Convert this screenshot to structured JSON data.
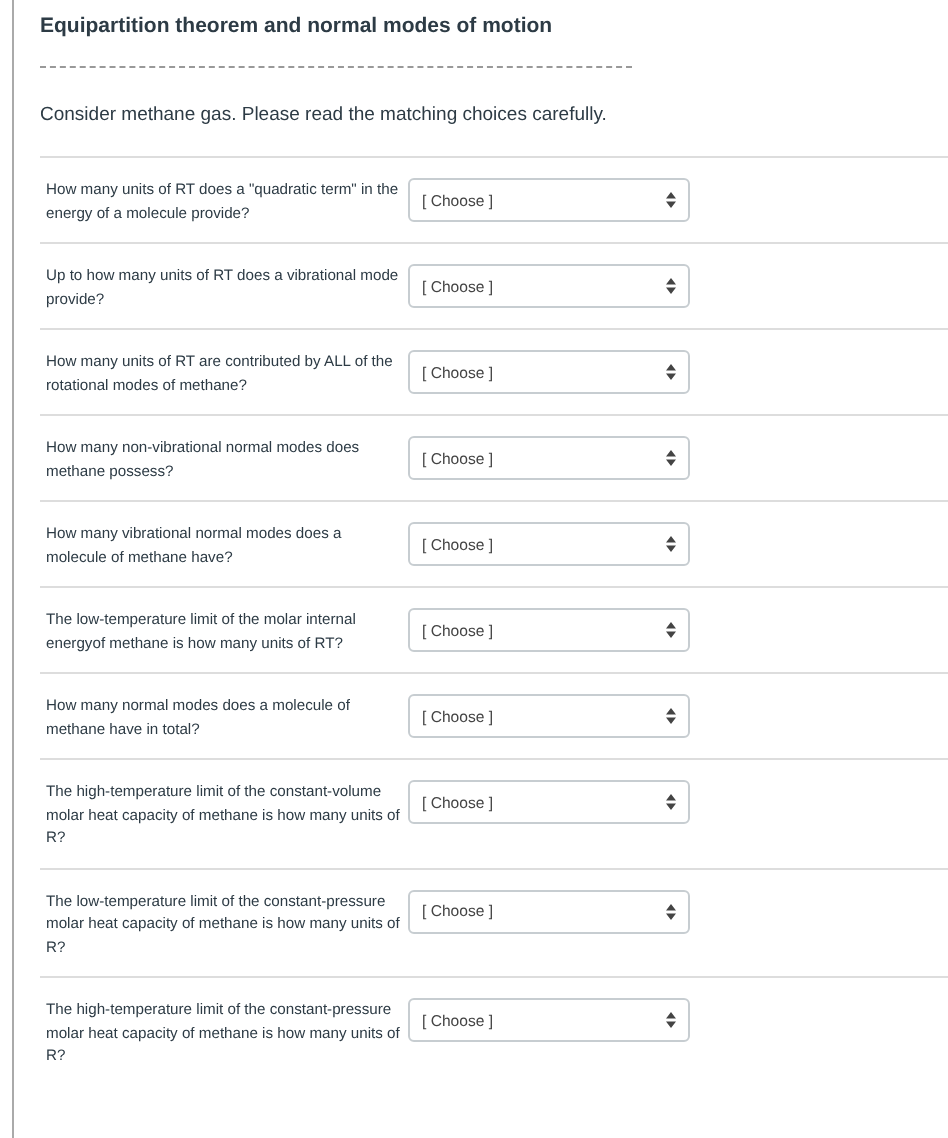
{
  "title": "Equipartition theorem and normal modes of motion",
  "intro": "Consider methane gas.  Please read the matching choices carefully.",
  "questions": [
    {
      "text": "How many units of RT does a \"quadratic term\" in the energy of a molecule provide?",
      "choice": "[ Choose ]"
    },
    {
      "text": "Up to how many units of RT does a vibrational mode provide?",
      "choice": "[ Choose ]"
    },
    {
      "text": "How many units of RT are contributed by ALL of the rotational modes of methane?",
      "choice": "[ Choose ]"
    },
    {
      "text": "How many non-vibrational normal modes does methane possess?",
      "choice": "[ Choose ]"
    },
    {
      "text": "How many vibrational normal modes does a molecule of methane have?",
      "choice": "[ Choose ]"
    },
    {
      "text": "The low-temperature limit of the molar internal energyof methane is how many units of RT?",
      "choice": "[ Choose ]"
    },
    {
      "text": "How many normal modes does a molecule of methane have in total?",
      "choice": "[ Choose ]"
    },
    {
      "text": "The high-temperature limit of the constant-volume molar heat capacity of methane is how many units of R?",
      "choice": "[ Choose ]"
    },
    {
      "text": "The low-temperature limit of the constant-pressure molar heat capacity of methane is how many units of R?",
      "choice": "[ Choose ]"
    },
    {
      "text": "The high-temperature limit of the constant-pressure molar heat capacity of methane is how many units of R?",
      "choice": "[ Choose ]"
    }
  ]
}
